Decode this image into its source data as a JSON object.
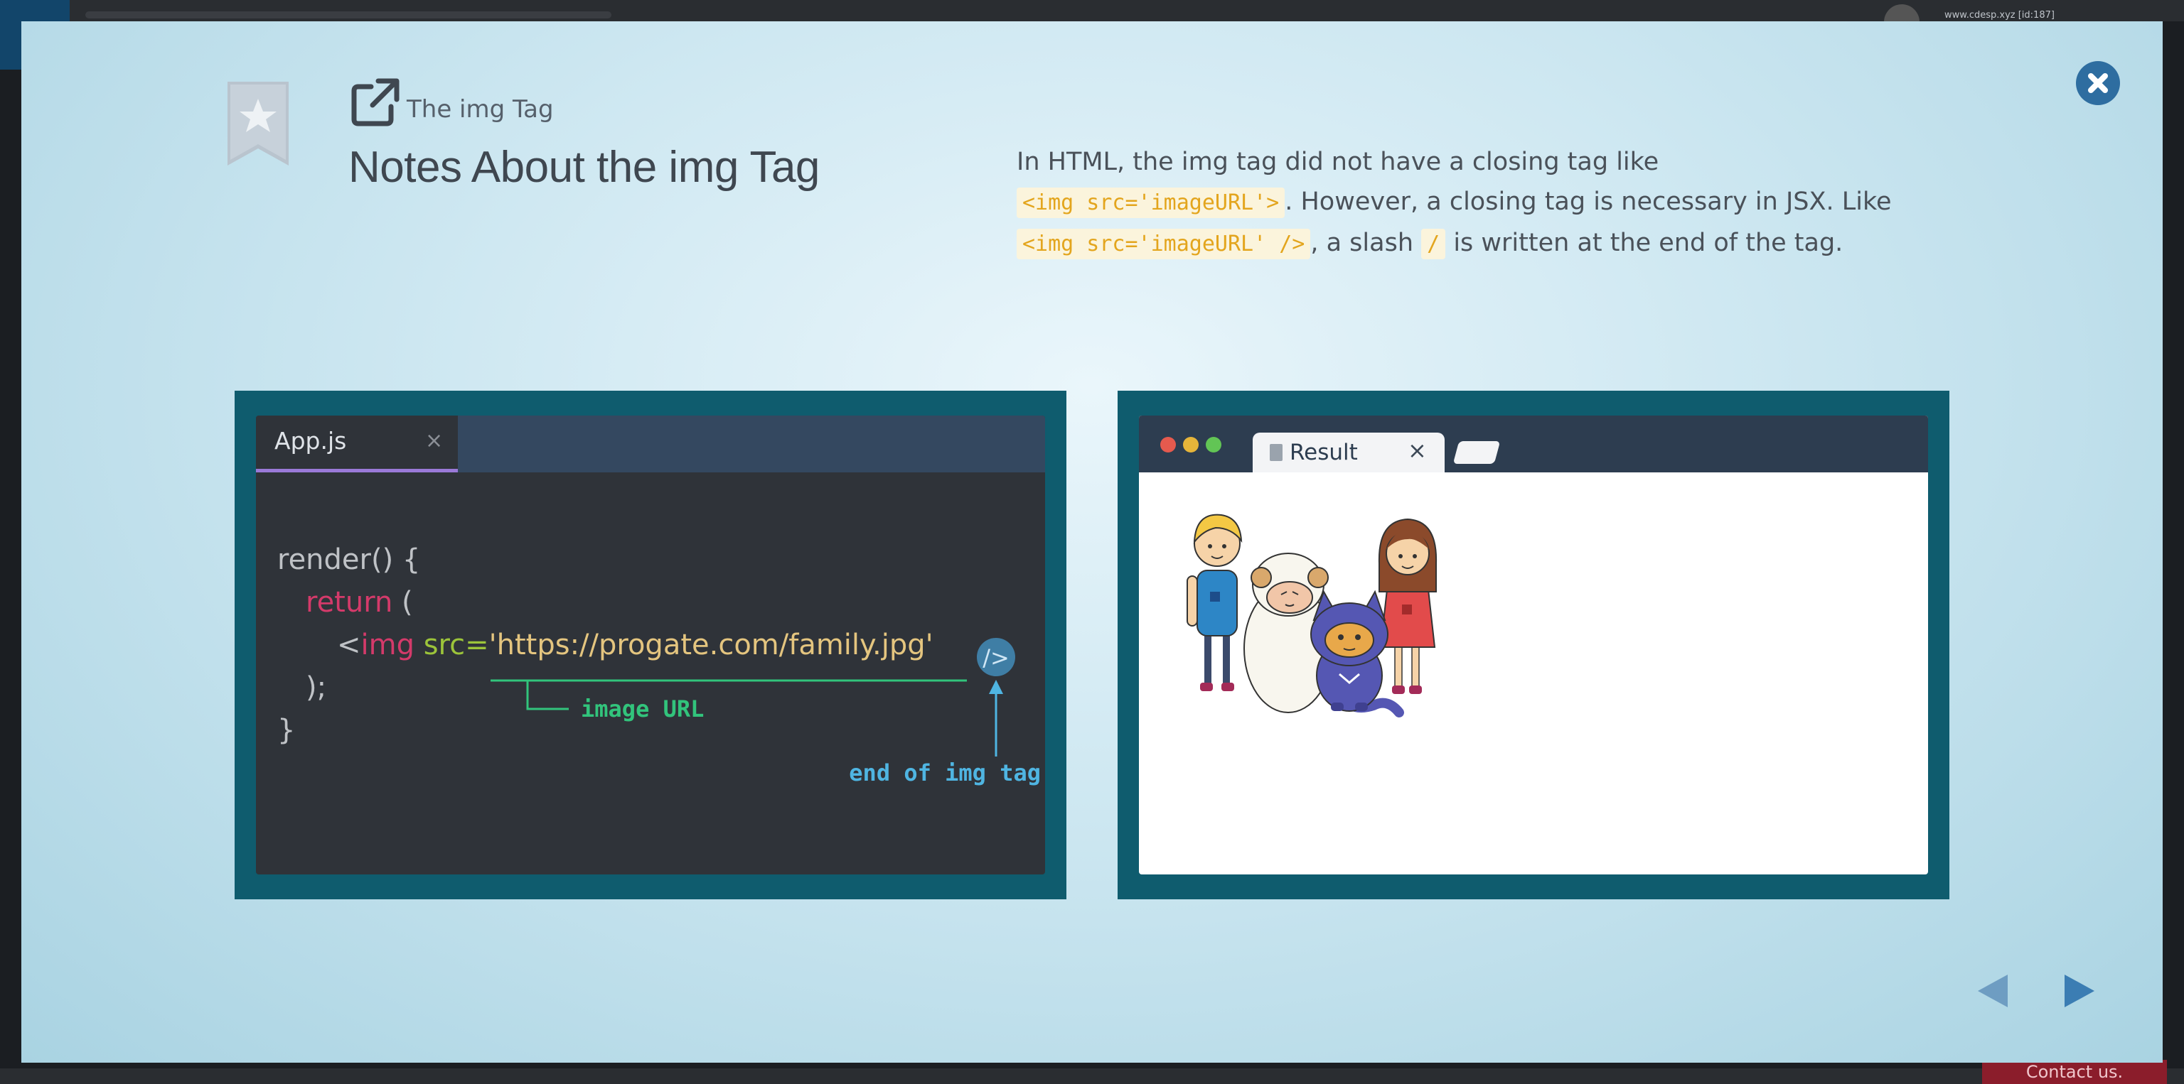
{
  "background": {
    "user_label": "www.cdesp.xyz [id:187]",
    "contact_label": "Contact us."
  },
  "modal": {
    "subtitle": "The img Tag",
    "title": "Notes About the img Tag",
    "description": {
      "line1": "In HTML, the img tag did not have a closing tag like",
      "code1": "<img src='imageURL'>",
      "line2": ". However, a closing tag is necessary in JSX. Like",
      "code2": "<img src='imageURL' />",
      "line3": ", a slash ",
      "code3": "/",
      "line4": " is written at the end of the tag."
    },
    "editor": {
      "tab_label": "App.js",
      "tab_close": "×",
      "lines": {
        "l1": "render() {",
        "l2_kw": "return",
        "l2_rest": " (",
        "l3_open": "<",
        "l3_tag": "img",
        "l3_attr": " src=",
        "l3_str": "'https://progate.com/family.jpg'",
        "l3_close": "/>",
        "l4": ");",
        "l5": "}"
      },
      "annotation_url": "image URL",
      "annotation_end": "end of img tag"
    },
    "browser": {
      "tab_label": "Result",
      "tab_close": "×"
    },
    "colors": {
      "accent": "#2e6da0",
      "panel": "#0f5c6e",
      "annotation_green": "#32c47c",
      "annotation_blue": "#4fb5e2"
    }
  }
}
